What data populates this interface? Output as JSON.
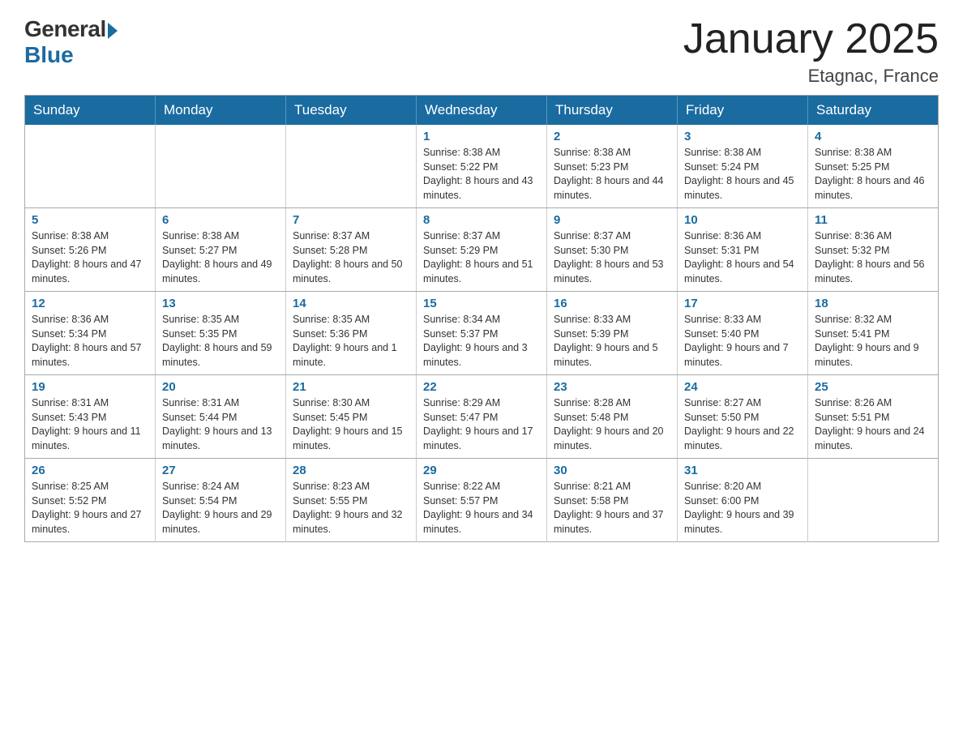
{
  "header": {
    "logo": {
      "general": "General",
      "blue": "Blue"
    },
    "title": "January 2025",
    "location": "Etagnac, France"
  },
  "days_of_week": [
    "Sunday",
    "Monday",
    "Tuesday",
    "Wednesday",
    "Thursday",
    "Friday",
    "Saturday"
  ],
  "weeks": [
    [
      {
        "day": null
      },
      {
        "day": null
      },
      {
        "day": null
      },
      {
        "day": 1,
        "sunrise": "8:38 AM",
        "sunset": "5:22 PM",
        "daylight": "8 hours and 43 minutes."
      },
      {
        "day": 2,
        "sunrise": "8:38 AM",
        "sunset": "5:23 PM",
        "daylight": "8 hours and 44 minutes."
      },
      {
        "day": 3,
        "sunrise": "8:38 AM",
        "sunset": "5:24 PM",
        "daylight": "8 hours and 45 minutes."
      },
      {
        "day": 4,
        "sunrise": "8:38 AM",
        "sunset": "5:25 PM",
        "daylight": "8 hours and 46 minutes."
      }
    ],
    [
      {
        "day": 5,
        "sunrise": "8:38 AM",
        "sunset": "5:26 PM",
        "daylight": "8 hours and 47 minutes."
      },
      {
        "day": 6,
        "sunrise": "8:38 AM",
        "sunset": "5:27 PM",
        "daylight": "8 hours and 49 minutes."
      },
      {
        "day": 7,
        "sunrise": "8:37 AM",
        "sunset": "5:28 PM",
        "daylight": "8 hours and 50 minutes."
      },
      {
        "day": 8,
        "sunrise": "8:37 AM",
        "sunset": "5:29 PM",
        "daylight": "8 hours and 51 minutes."
      },
      {
        "day": 9,
        "sunrise": "8:37 AM",
        "sunset": "5:30 PM",
        "daylight": "8 hours and 53 minutes."
      },
      {
        "day": 10,
        "sunrise": "8:36 AM",
        "sunset": "5:31 PM",
        "daylight": "8 hours and 54 minutes."
      },
      {
        "day": 11,
        "sunrise": "8:36 AM",
        "sunset": "5:32 PM",
        "daylight": "8 hours and 56 minutes."
      }
    ],
    [
      {
        "day": 12,
        "sunrise": "8:36 AM",
        "sunset": "5:34 PM",
        "daylight": "8 hours and 57 minutes."
      },
      {
        "day": 13,
        "sunrise": "8:35 AM",
        "sunset": "5:35 PM",
        "daylight": "8 hours and 59 minutes."
      },
      {
        "day": 14,
        "sunrise": "8:35 AM",
        "sunset": "5:36 PM",
        "daylight": "9 hours and 1 minute."
      },
      {
        "day": 15,
        "sunrise": "8:34 AM",
        "sunset": "5:37 PM",
        "daylight": "9 hours and 3 minutes."
      },
      {
        "day": 16,
        "sunrise": "8:33 AM",
        "sunset": "5:39 PM",
        "daylight": "9 hours and 5 minutes."
      },
      {
        "day": 17,
        "sunrise": "8:33 AM",
        "sunset": "5:40 PM",
        "daylight": "9 hours and 7 minutes."
      },
      {
        "day": 18,
        "sunrise": "8:32 AM",
        "sunset": "5:41 PM",
        "daylight": "9 hours and 9 minutes."
      }
    ],
    [
      {
        "day": 19,
        "sunrise": "8:31 AM",
        "sunset": "5:43 PM",
        "daylight": "9 hours and 11 minutes."
      },
      {
        "day": 20,
        "sunrise": "8:31 AM",
        "sunset": "5:44 PM",
        "daylight": "9 hours and 13 minutes."
      },
      {
        "day": 21,
        "sunrise": "8:30 AM",
        "sunset": "5:45 PM",
        "daylight": "9 hours and 15 minutes."
      },
      {
        "day": 22,
        "sunrise": "8:29 AM",
        "sunset": "5:47 PM",
        "daylight": "9 hours and 17 minutes."
      },
      {
        "day": 23,
        "sunrise": "8:28 AM",
        "sunset": "5:48 PM",
        "daylight": "9 hours and 20 minutes."
      },
      {
        "day": 24,
        "sunrise": "8:27 AM",
        "sunset": "5:50 PM",
        "daylight": "9 hours and 22 minutes."
      },
      {
        "day": 25,
        "sunrise": "8:26 AM",
        "sunset": "5:51 PM",
        "daylight": "9 hours and 24 minutes."
      }
    ],
    [
      {
        "day": 26,
        "sunrise": "8:25 AM",
        "sunset": "5:52 PM",
        "daylight": "9 hours and 27 minutes."
      },
      {
        "day": 27,
        "sunrise": "8:24 AM",
        "sunset": "5:54 PM",
        "daylight": "9 hours and 29 minutes."
      },
      {
        "day": 28,
        "sunrise": "8:23 AM",
        "sunset": "5:55 PM",
        "daylight": "9 hours and 32 minutes."
      },
      {
        "day": 29,
        "sunrise": "8:22 AM",
        "sunset": "5:57 PM",
        "daylight": "9 hours and 34 minutes."
      },
      {
        "day": 30,
        "sunrise": "8:21 AM",
        "sunset": "5:58 PM",
        "daylight": "9 hours and 37 minutes."
      },
      {
        "day": 31,
        "sunrise": "8:20 AM",
        "sunset": "6:00 PM",
        "daylight": "9 hours and 39 minutes."
      },
      {
        "day": null
      }
    ]
  ]
}
